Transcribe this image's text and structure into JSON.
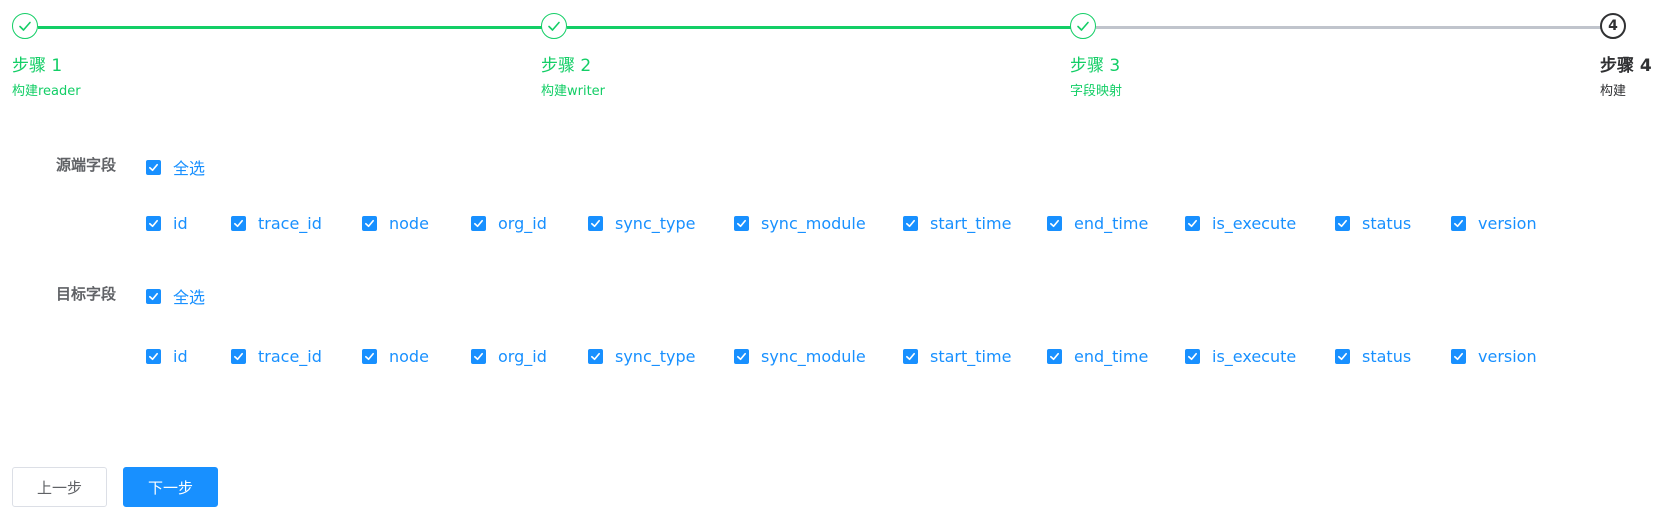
{
  "steps": [
    {
      "title": "步骤 1",
      "desc": "构建reader",
      "status": "done"
    },
    {
      "title": "步骤 2",
      "desc": "构建writer",
      "status": "done"
    },
    {
      "title": "步骤 3",
      "desc": "字段映射",
      "status": "done"
    },
    {
      "title": "步骤 4",
      "desc": "构建",
      "status": "current",
      "number": "4"
    }
  ],
  "colors": {
    "success": "#13ce66",
    "primary": "#1890ff",
    "pending_line": "#c0c4cc",
    "text": "#303133",
    "muted": "#606266"
  },
  "source": {
    "label": "源端字段",
    "select_all": "全选",
    "fields": [
      "id",
      "trace_id",
      "node",
      "org_id",
      "sync_type",
      "sync_module",
      "start_time",
      "end_time",
      "is_execute",
      "status",
      "version"
    ]
  },
  "target": {
    "label": "目标字段",
    "select_all": "全选",
    "fields": [
      "id",
      "trace_id",
      "node",
      "org_id",
      "sync_type",
      "sync_module",
      "start_time",
      "end_time",
      "is_execute",
      "status",
      "version"
    ]
  },
  "buttons": {
    "prev": "上一步",
    "next": "下一步"
  }
}
